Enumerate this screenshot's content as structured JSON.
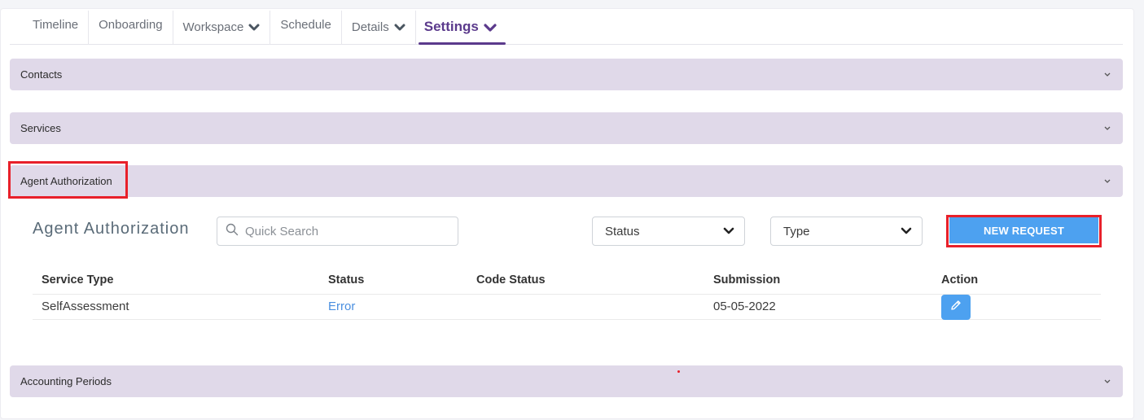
{
  "tabs": [
    {
      "label": "Timeline"
    },
    {
      "label": "Onboarding"
    },
    {
      "label": "Workspace"
    },
    {
      "label": "Schedule"
    },
    {
      "label": "Details"
    },
    {
      "label": "Settings",
      "active": true
    }
  ],
  "accordions": {
    "contacts": "Contacts",
    "services": "Services",
    "agent_authorization": "Agent Authorization",
    "accounting_periods": "Accounting Periods"
  },
  "panel": {
    "title": "Agent Authorization",
    "search_placeholder": "Quick Search",
    "status_select": "Status",
    "type_select": "Type",
    "new_request_label": "NEW REQUEST"
  },
  "table": {
    "columns": [
      "Service Type",
      "Status",
      "Code Status",
      "Submission",
      "Action"
    ],
    "rows": [
      {
        "service_type": "SelfAssessment",
        "status": "Error",
        "code_status": "",
        "submission": "05-05-2022"
      }
    ]
  },
  "colors": {
    "accent": "#5b3a8c",
    "accordion_bg": "#e0d9e9",
    "button_blue": "#4da1f0",
    "annotation_red": "#e8202a"
  }
}
